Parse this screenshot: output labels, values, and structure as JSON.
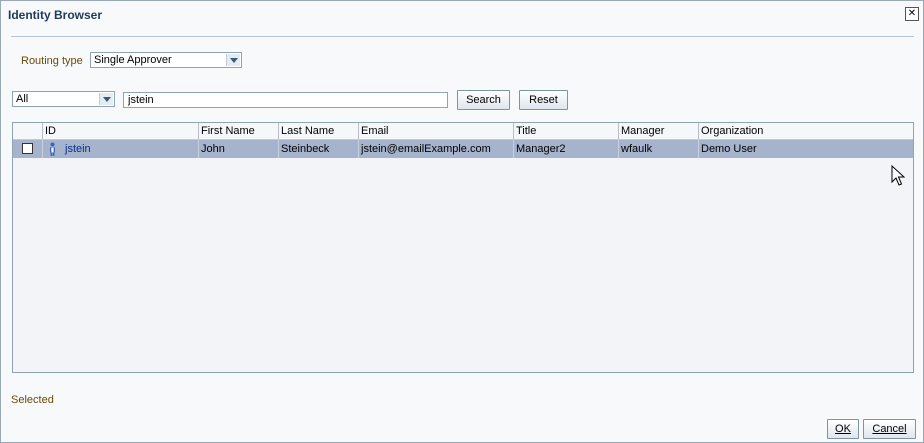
{
  "dialog": {
    "title": "Identity Browser",
    "close_label": "✕"
  },
  "routing": {
    "label": "Routing type",
    "selected": "Single Approver"
  },
  "search": {
    "scope_selected": "All",
    "query": "jstein",
    "search_label": "Search",
    "reset_label": "Reset"
  },
  "table": {
    "columns": [
      "ID",
      "First Name",
      "Last Name",
      "Email",
      "Title",
      "Manager",
      "Organization"
    ],
    "rows": [
      {
        "id": "jstein",
        "first_name": "John",
        "last_name": "Steinbeck",
        "email": "jstein@emailExample.com",
        "title": "Manager2",
        "manager": "wfaulk",
        "organization": "Demo User",
        "selected_row": true,
        "checked": false
      }
    ]
  },
  "footer": {
    "selected_label": "Selected",
    "ok_label": "OK",
    "cancel_label": "Cancel"
  },
  "colors": {
    "title": "#1f3a57",
    "label": "#6b4a06",
    "row_highlight": "#a5b3cc",
    "link": "#0a2f8a"
  },
  "icons": {
    "user": "user-icon",
    "close": "close-icon",
    "dropdown": "chevron-down-icon",
    "cursor": "mouse-pointer-icon"
  }
}
